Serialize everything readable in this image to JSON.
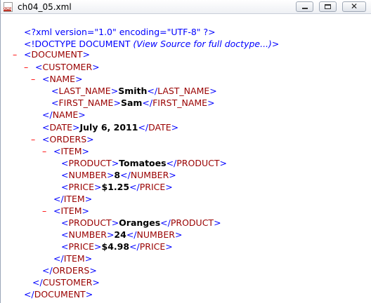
{
  "window": {
    "title": "ch04_05.xml",
    "icon_label": "XML",
    "close_glyph": "✕"
  },
  "xml": {
    "declaration": "<?xml version=\"1.0\" encoding=\"UTF-8\" ?>",
    "doctype_prefix": "<!DOCTYPE DOCUMENT ",
    "doctype_italic": "(View Source for full doctype...)",
    "doctype_suffix": ">",
    "toggle": "–",
    "lt": "<",
    "lt_close": "</",
    "gt": ">",
    "tags": {
      "document": "DOCUMENT",
      "customer": "CUSTOMER",
      "name": "NAME",
      "last_name": "LAST_NAME",
      "first_name": "FIRST_NAME",
      "date": "DATE",
      "orders": "ORDERS",
      "item": "ITEM",
      "product": "PRODUCT",
      "number": "NUMBER",
      "price": "PRICE"
    },
    "values": {
      "last_name": "Smith",
      "first_name": "Sam",
      "date": "July 6, 2011",
      "item1": {
        "product": "Tomatoes",
        "number": "8",
        "price": "$1.25"
      },
      "item2": {
        "product": "Oranges",
        "number": "24",
        "price": "$4.98"
      }
    }
  }
}
